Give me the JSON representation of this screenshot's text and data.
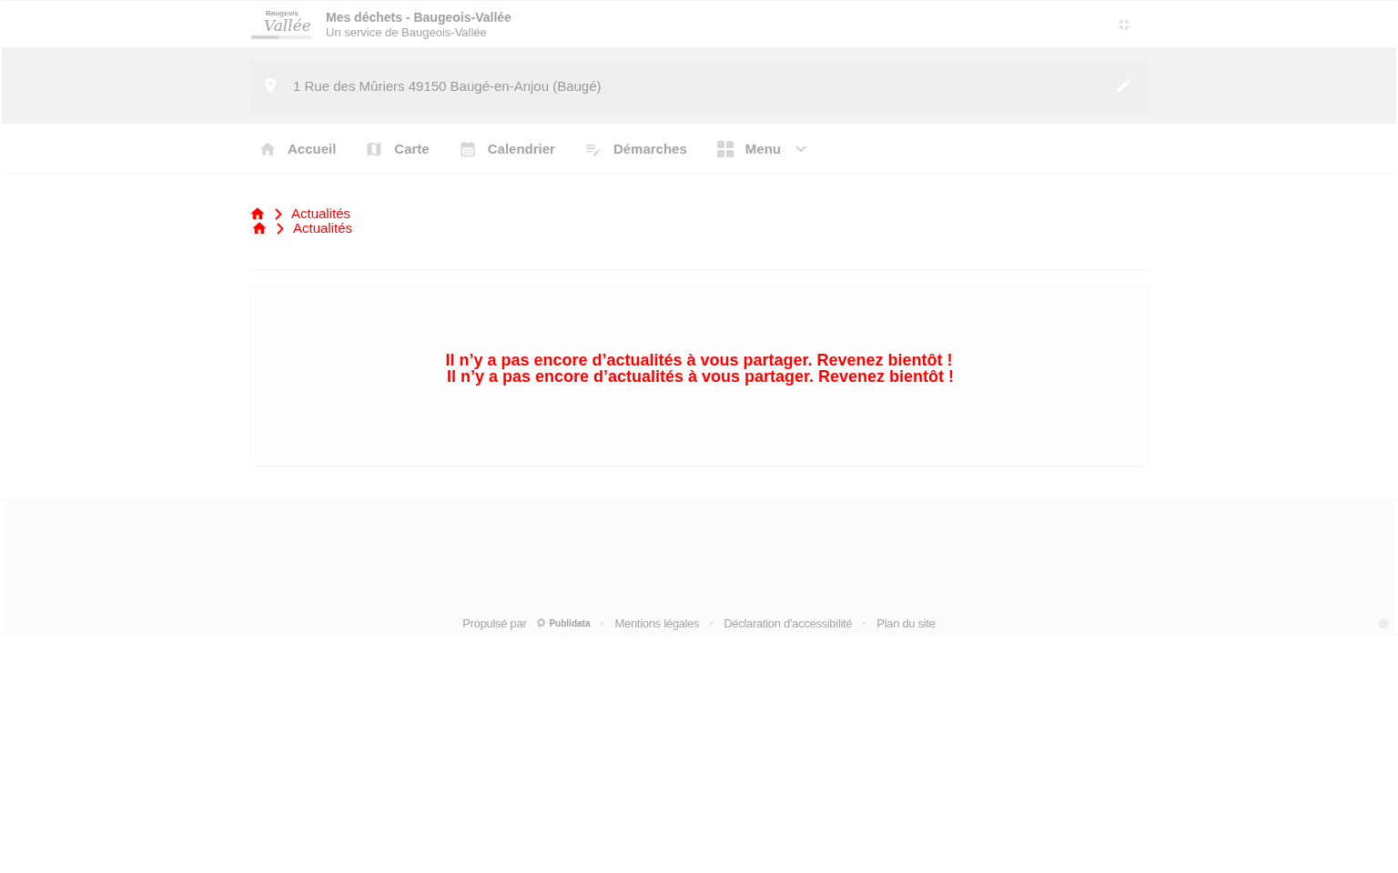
{
  "header": {
    "logo": {
      "top": "Baugeois",
      "script": "Vallée"
    },
    "title": "Mes déchets - Baugeois-Vallée",
    "subtitle": "Un service de Baugeois-Vallée"
  },
  "address": {
    "value": "1 Rue des Mûriers 49150 Baugé-en-Anjou (Baugé)"
  },
  "nav": [
    {
      "label": "Accueil",
      "has_menu": false
    },
    {
      "label": "Carte",
      "has_menu": false
    },
    {
      "label": "Calendrier",
      "has_menu": false
    },
    {
      "label": "Démarches",
      "has_menu": false
    },
    {
      "label": "Menu",
      "has_menu": true
    }
  ],
  "breadcrumbs": [
    {
      "items": [
        "Actualités"
      ]
    },
    {
      "items": [
        "Actualités"
      ]
    }
  ],
  "news": {
    "messages": [
      "Il n’y a pas encore d’actualités à vous partager. Revenez bientôt !",
      "Il n’y a pas encore d’actualités à vous partager. Revenez bientôt !"
    ]
  },
  "footer": {
    "powered_by": "Propulsé par",
    "brand": "Publidata",
    "links": [
      "Mentions légales",
      "Déclaration d'accessibilité",
      "Plan du site"
    ]
  }
}
